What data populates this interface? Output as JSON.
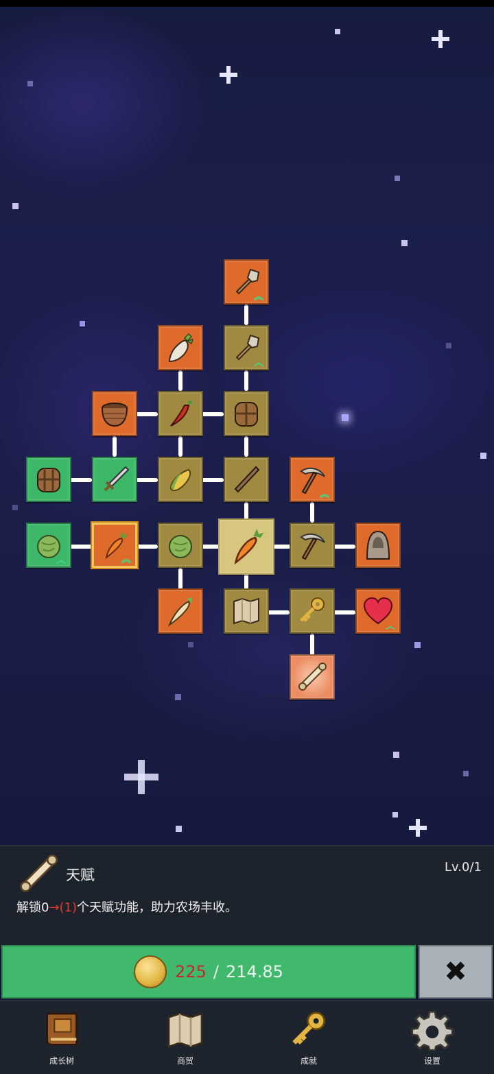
{
  "talent_tree": {
    "nodes": [
      {
        "name": "shovel-node-1",
        "icon": "shovel-icon",
        "color": "orange",
        "upgradable": true
      },
      {
        "name": "radish-node",
        "icon": "radish-icon",
        "color": "orange",
        "upgradable": false
      },
      {
        "name": "shovel-node-2",
        "icon": "shovel-icon",
        "color": "olive",
        "upgradable": true
      },
      {
        "name": "bowl-node",
        "icon": "bowl-icon",
        "color": "orange",
        "upgradable": false
      },
      {
        "name": "chili-node",
        "icon": "chili-icon",
        "color": "olive",
        "upgradable": false
      },
      {
        "name": "backpack-node-1",
        "icon": "backpack-icon",
        "color": "olive",
        "upgradable": false
      },
      {
        "name": "backpack-node-2",
        "icon": "backpack-icon",
        "color": "green",
        "upgradable": false
      },
      {
        "name": "sword-node",
        "icon": "sword-icon",
        "color": "green",
        "upgradable": false
      },
      {
        "name": "corn-node",
        "icon": "corn-icon",
        "color": "olive",
        "upgradable": false
      },
      {
        "name": "stick-node",
        "icon": "stick-icon",
        "color": "olive",
        "upgradable": false
      },
      {
        "name": "pickaxe-node-1",
        "icon": "pickaxe-icon",
        "color": "orange",
        "upgradable": true
      },
      {
        "name": "cabbage-node-1",
        "icon": "cabbage-icon",
        "color": "green",
        "upgradable": true
      },
      {
        "name": "carrot-node-selected",
        "icon": "carrot-icon",
        "color": "orange",
        "upgradable": true
      },
      {
        "name": "cabbage-node-2",
        "icon": "cabbage-icon",
        "color": "olive",
        "upgradable": false
      },
      {
        "name": "carrot-node-center",
        "icon": "carrot-icon",
        "color": "center",
        "upgradable": false
      },
      {
        "name": "pickaxe-node-2",
        "icon": "pickaxe-icon",
        "color": "olive",
        "upgradable": false
      },
      {
        "name": "hooded-figure-node",
        "icon": "hooded-figure-icon",
        "color": "orange",
        "upgradable": false
      },
      {
        "name": "parsnip-node",
        "icon": "parsnip-icon",
        "color": "orange",
        "upgradable": false
      },
      {
        "name": "map-node",
        "icon": "map-icon",
        "color": "olive",
        "upgradable": false
      },
      {
        "name": "key-node",
        "icon": "key-icon",
        "color": "olive",
        "upgradable": false
      },
      {
        "name": "heart-node",
        "icon": "heart-icon",
        "color": "orange",
        "upgradable": true
      },
      {
        "name": "scroll-node",
        "icon": "scroll-icon",
        "color": "salmon",
        "upgradable": false
      }
    ]
  },
  "panel": {
    "icon": "scroll-icon",
    "title": "天赋",
    "level": "Lv.0/1",
    "desc_prefix": "解锁0",
    "desc_highlight": "→(1)",
    "desc_suffix": "个天赋功能，助力农场丰收。"
  },
  "purchase": {
    "icon": "coin-icon",
    "price": "225",
    "separator": "/",
    "balance": "214.85",
    "close_label": "✖"
  },
  "nav": [
    {
      "label": "成长树",
      "icon": "book-icon"
    },
    {
      "label": "商贸",
      "icon": "map-icon"
    },
    {
      "label": "成就",
      "icon": "key-icon"
    },
    {
      "label": "设置",
      "icon": "gear-icon"
    }
  ],
  "colors": {
    "orange": "#de6a2c",
    "olive": "#a08940",
    "green": "#3cb868",
    "salmon": "#f0946c",
    "buy_button": "#41b96d",
    "price_insufficient": "#bf2a2a",
    "highlight": "#e23a2e"
  }
}
